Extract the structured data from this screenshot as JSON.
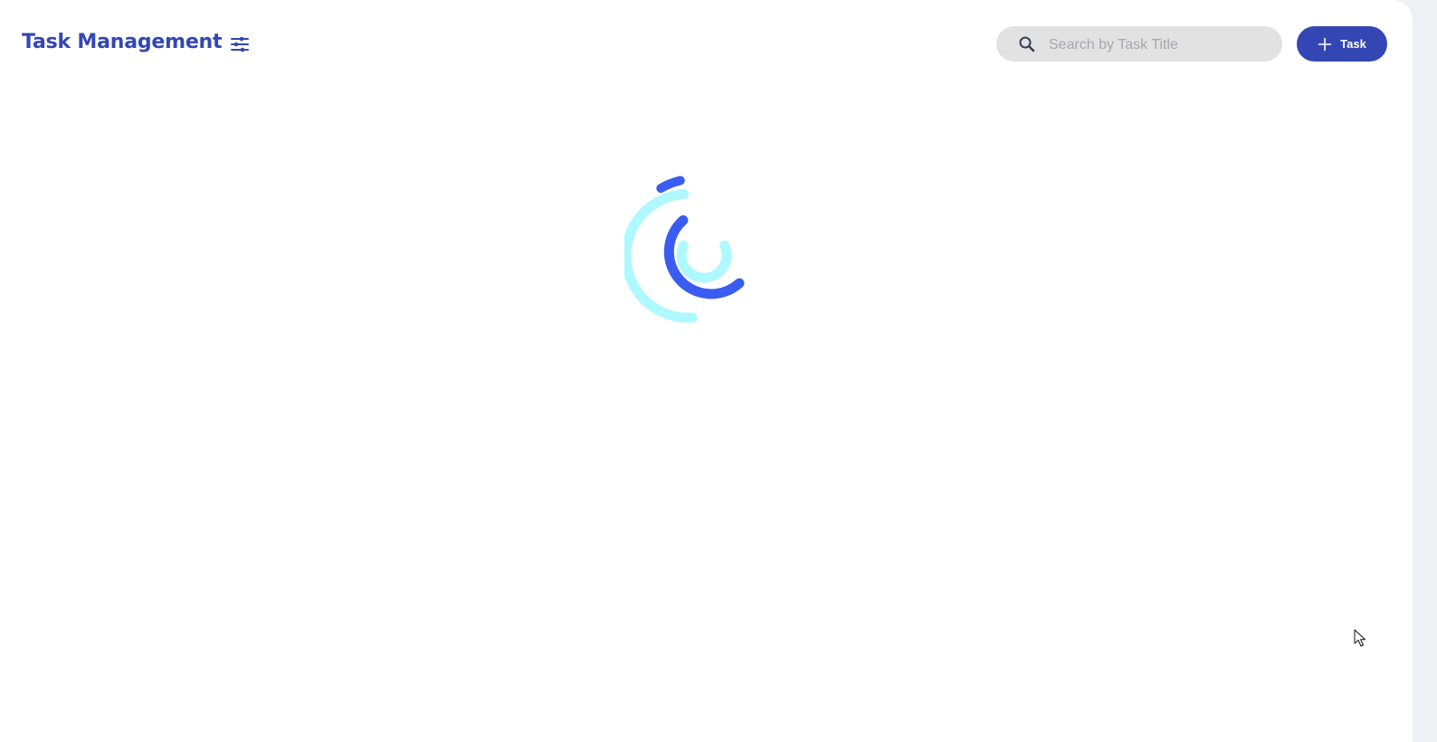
{
  "header": {
    "title": "Task Management"
  },
  "icons": {
    "filter": "sliders-icon",
    "search": "search-icon",
    "add": "plus-icon"
  },
  "search": {
    "placeholder": "Search by Task Title",
    "value": ""
  },
  "actions": {
    "add_task_label": "Task"
  },
  "colors": {
    "brand": "#3346b4",
    "spinner_dark": "#3b5cf2",
    "spinner_light": "#aef8ff",
    "search_bg": "#e2e2e2"
  },
  "status": {
    "loading": true
  }
}
